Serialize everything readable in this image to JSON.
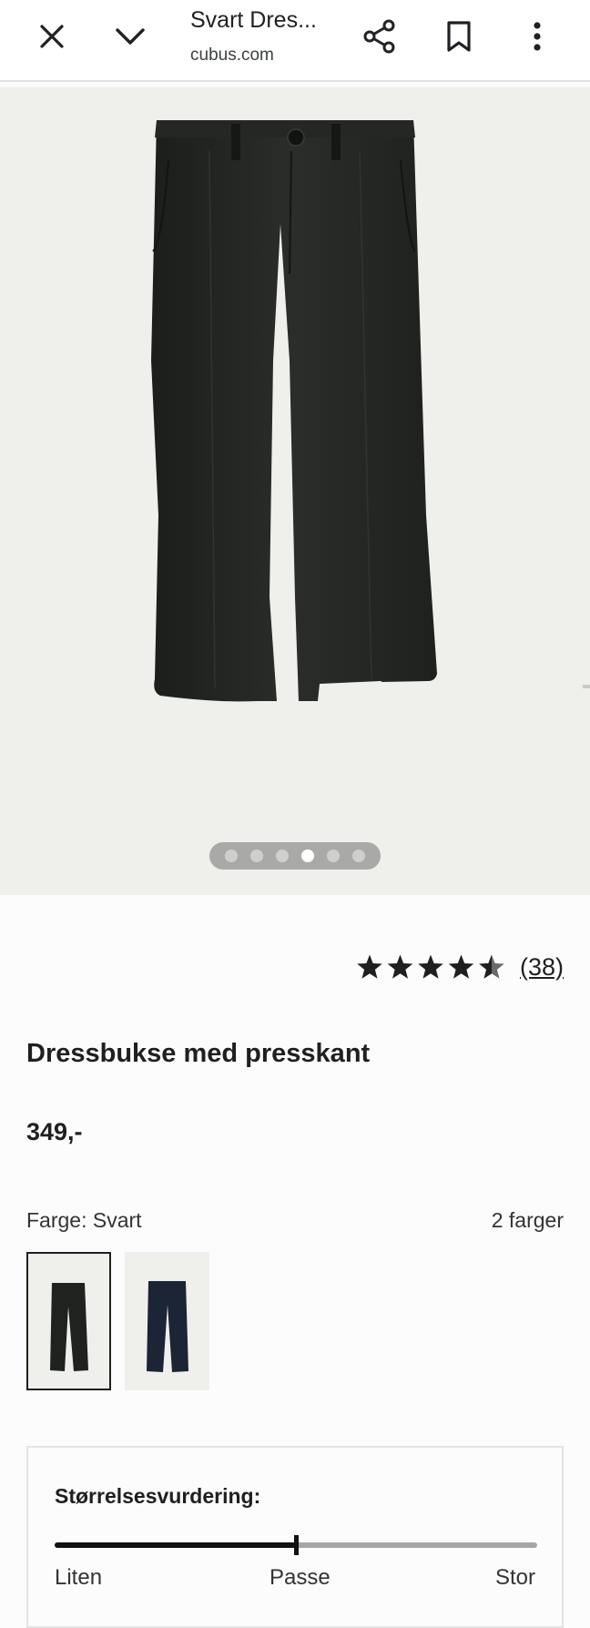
{
  "browser": {
    "page_title": "Svart Dres...",
    "url": "cubus.com",
    "icons": [
      "close-icon",
      "chevron-down-icon",
      "share-icon",
      "bookmark-icon",
      "more-vert-icon"
    ]
  },
  "gallery": {
    "image_count": 6,
    "active_index": 3
  },
  "rating": {
    "stars": 4.5,
    "count": "(38)"
  },
  "product": {
    "title": "Dressbukse med presskant",
    "price": "349,-"
  },
  "colors": {
    "label": "Farge: Svart",
    "count_label": "2 farger",
    "swatches": [
      {
        "name": "svart",
        "hex": "#1f221f",
        "selected": true
      },
      {
        "name": "marine",
        "hex": "#1c2535",
        "selected": false
      }
    ]
  },
  "size_rating": {
    "title": "Størrelsesvurdering:",
    "value": 0.5,
    "labels": [
      "Liten",
      "Passe",
      "Stor"
    ]
  },
  "colors_theme": {
    "background": "#fcfcfc",
    "gallery_bg": "#efefec",
    "text": "#1f1f1f"
  }
}
